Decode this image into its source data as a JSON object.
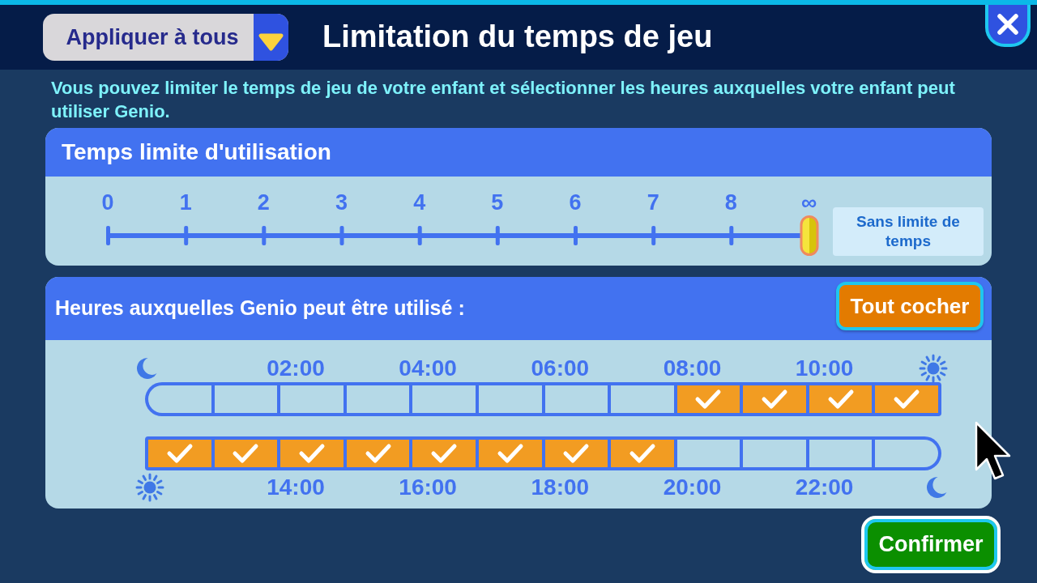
{
  "header": {
    "apply_all": {
      "label": "Appliquer à tous"
    },
    "title": "Limitation du temps de jeu"
  },
  "description": "Vous pouvez limiter le temps de jeu de votre enfant et sélectionner les heures auxquelles votre enfant peut utiliser Genio.",
  "time_limit": {
    "title": "Temps limite d'utilisation",
    "ticks": [
      "0",
      "1",
      "2",
      "3",
      "4",
      "5",
      "6",
      "7",
      "8",
      "∞"
    ],
    "slider": {
      "level": 1,
      "reading": "Sans limite de temps"
    }
  },
  "hours": {
    "title": "Heures auxquelles Genio peut être utilisé :",
    "check_all": {
      "label": "Tout cocher"
    },
    "rows": [
      {
        "labels": [
          "02:00",
          "04:00",
          "06:00",
          "08:00",
          "10:00"
        ],
        "slots": [
          {
            "checked": false
          },
          {
            "checked": false
          },
          {
            "checked": false
          },
          {
            "checked": false
          },
          {
            "checked": false
          },
          {
            "checked": false
          },
          {
            "checked": false
          },
          {
            "checked": false
          },
          {
            "checked": true
          },
          {
            "checked": true
          },
          {
            "checked": true
          },
          {
            "checked": true
          }
        ]
      },
      {
        "labels": [
          "14:00",
          "16:00",
          "18:00",
          "20:00",
          "22:00"
        ],
        "slots": [
          {
            "checked": true
          },
          {
            "checked": true
          },
          {
            "checked": true
          },
          {
            "checked": true
          },
          {
            "checked": true
          },
          {
            "checked": true
          },
          {
            "checked": true
          },
          {
            "checked": true
          },
          {
            "checked": false
          },
          {
            "checked": false
          },
          {
            "checked": false
          },
          {
            "checked": false
          }
        ]
      }
    ]
  },
  "confirm": {
    "label": "Confirmer"
  }
}
